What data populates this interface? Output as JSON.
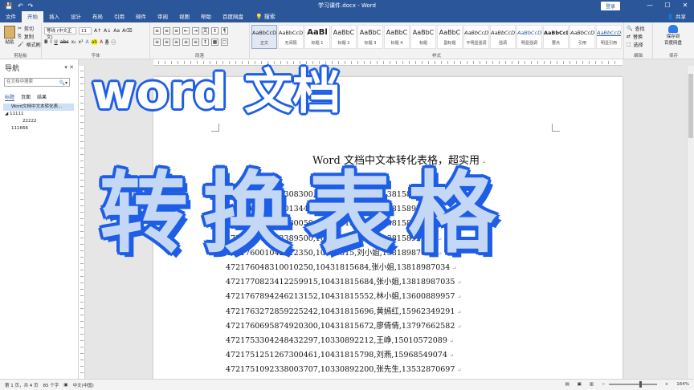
{
  "window": {
    "title": "学习课件.docx - Word",
    "signin": "登录",
    "share": "共享",
    "qat": [
      "💾",
      "↶",
      "↷"
    ],
    "controls": [
      "—",
      "☐",
      "✕"
    ]
  },
  "tabs": [
    "文件",
    "开始",
    "插入",
    "设计",
    "布局",
    "引用",
    "邮件",
    "审阅",
    "视图",
    "帮助",
    "百度网盘"
  ],
  "active_tab": "开始",
  "tellme": "搜索",
  "ribbon": {
    "clipboard": {
      "paste": "粘贴",
      "cut": "剪切",
      "copy": "复制",
      "painter": "格式刷",
      "label": "剪贴板"
    },
    "font": {
      "name": "等线 (中文正文)",
      "size": "11",
      "label": "字体"
    },
    "paragraph": {
      "label": "段落"
    },
    "styles": {
      "label": "样式",
      "items": [
        {
          "preview": "AaBbCcDd",
          "name": "正文"
        },
        {
          "preview": "AaBbCcDd",
          "name": "无间隔"
        },
        {
          "preview": "AaBl",
          "name": "标题 1"
        },
        {
          "preview": "AaBbC",
          "name": "标题 2"
        },
        {
          "preview": "AaBbC",
          "name": "标题 3"
        },
        {
          "preview": "AaBbC",
          "name": "标题 4"
        },
        {
          "preview": "AaBbC",
          "name": "标题"
        },
        {
          "preview": "AaBbC",
          "name": "副标题"
        },
        {
          "preview": "AaBbCcDd",
          "name": "不明显强调"
        },
        {
          "preview": "AaBbCcDd",
          "name": "强调"
        },
        {
          "preview": "AaBbCcDd",
          "name": "明显强调"
        },
        {
          "preview": "AaBbCcDd",
          "name": "要点"
        },
        {
          "preview": "AaBbCcDd",
          "name": "引用"
        },
        {
          "preview": "AaBbCcDd",
          "name": "明显引用"
        }
      ]
    },
    "editing": {
      "find": "查找",
      "replace": "替换",
      "select": "选择",
      "label": "编辑"
    },
    "save": {
      "label1": "保存到",
      "label2": "百度网盘",
      "group": "保存"
    }
  },
  "nav": {
    "title": "导航",
    "search_placeholder": "在文档中搜索",
    "tabs": [
      "标题",
      "页面",
      "结果"
    ],
    "headings": [
      "Word文档中文本转化表...",
      "11111",
      "22222",
      "111666"
    ]
  },
  "document": {
    "heading": "Word 文档中文本转化表格，超实用",
    "lines": [
      "472176062102308300,10330892,张先生,13815892276",
      "472176093340013440,10330892,张先生,13815892277",
      "472176014512080050,10431815,李先生,13815892277",
      "472176078502389500,10330892,王先生,13815892278",
      "472176001042212350,10431815,刘小姐,13818987036",
      "472176048310010250,10431815684,张小姐,13818987034",
      "4721770823412259915,10431815684,张小姐,13818987035",
      "4721767894246213152,10431815552,林小姐,13600889957",
      "4721763272859225242,10431815696,黄嫣红,15962349291",
      "4721760695874920300,10431815672,廖倩倩,13797662582",
      "4721753304248432297,10330892212,王峥,15010572089",
      "4721751251267300461,10431815798,刘燕,15968549074",
      "4721751092338003707,10330892200,张先生,13532870697"
    ]
  },
  "overlay": {
    "line1": "word 文档",
    "line2": "转换表格",
    "stroke_color": "#1e5ee6"
  },
  "status": {
    "page": "第 1 页，共 4 页",
    "words": "85 个字",
    "lang": "中文(中国)",
    "zoom": "164%"
  },
  "colors": {
    "accent": "#2b579a"
  }
}
